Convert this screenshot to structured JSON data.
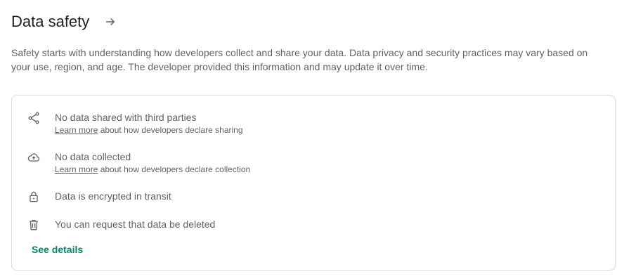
{
  "header": {
    "title": "Data safety"
  },
  "description": "Safety starts with understanding how developers collect and share your data. Data privacy and security practices may vary based on your use, region, and age. The developer provided this information and may update it over time.",
  "items": [
    {
      "icon": "share-icon",
      "main": "No data shared with third parties",
      "link": "Learn more",
      "sub": " about how developers declare sharing"
    },
    {
      "icon": "cloud-upload-icon",
      "main": "No data collected",
      "link": "Learn more",
      "sub": " about how developers declare collection"
    },
    {
      "icon": "lock-icon",
      "main": "Data is encrypted in transit"
    },
    {
      "icon": "trash-icon",
      "main": "You can request that data be deleted"
    }
  ],
  "see_details": "See details",
  "colors": {
    "accent": "#01875f",
    "text_primary": "#202124",
    "text_secondary": "#5f6368",
    "border": "#dadce0"
  }
}
